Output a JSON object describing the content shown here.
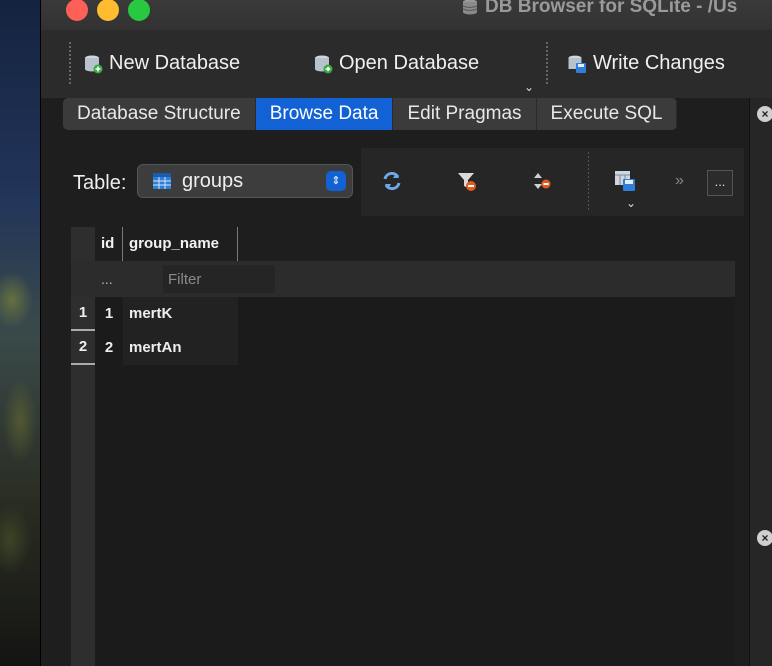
{
  "window": {
    "title": "DB Browser for SQLite - /Us"
  },
  "toolbar": {
    "new_database": "New Database",
    "open_database": "Open Database",
    "write_changes": "Write Changes"
  },
  "tabs": [
    {
      "label": "Database Structure",
      "active": false
    },
    {
      "label": "Browse Data",
      "active": true
    },
    {
      "label": "Edit Pragmas",
      "active": false
    },
    {
      "label": "Execute SQL",
      "active": false
    }
  ],
  "browse": {
    "table_label": "Table:",
    "selected_table": "groups",
    "actions": [
      "refresh-icon",
      "clear-filters-icon",
      "sort-icon",
      "save-table-icon"
    ],
    "more_label": "...",
    "columns": [
      "id",
      "group_name"
    ],
    "filter_dots": "...",
    "filter_placeholder": "Filter",
    "rows": [
      {
        "rownum": "1",
        "id": "1",
        "group_name": "mertK"
      },
      {
        "rownum": "2",
        "id": "2",
        "group_name": "mertAn"
      }
    ]
  },
  "colors": {
    "accent": "#1262d6",
    "close": "#fe5f57",
    "minimize": "#febc2e",
    "zoom": "#28c840"
  }
}
